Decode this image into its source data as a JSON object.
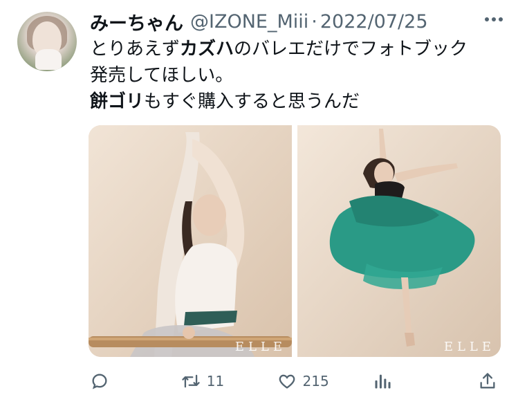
{
  "tweet": {
    "author_name": "みーちゃん",
    "handle": "@IZONE_Miii",
    "separator": "·",
    "date": "2022/07/25",
    "text_lines": [
      [
        {
          "t": "とりあえず",
          "b": false
        },
        {
          "t": "カズハ",
          "b": true
        },
        {
          "t": "のバレエだけでフォトブック",
          "b": false
        }
      ],
      [
        {
          "t": "発売してほしい。",
          "b": false
        }
      ],
      [
        {
          "t": "餅ゴリ",
          "b": true
        },
        {
          "t": "もすぐ購入すると思うんだ",
          "b": false
        }
      ]
    ],
    "media": [
      {
        "watermark": "ELLE"
      },
      {
        "watermark": "ELLE"
      }
    ],
    "actions": {
      "reply_icon": "reply-icon",
      "retweet_icon": "retweet-icon",
      "retweet_count": "11",
      "like_icon": "heart-icon",
      "like_count": "215",
      "views_icon": "analytics-icon",
      "share_icon": "share-icon"
    }
  },
  "colors": {
    "text": "#0f1419",
    "muted": "#536471",
    "background": "#ffffff",
    "tutu": "#2a9a86"
  }
}
